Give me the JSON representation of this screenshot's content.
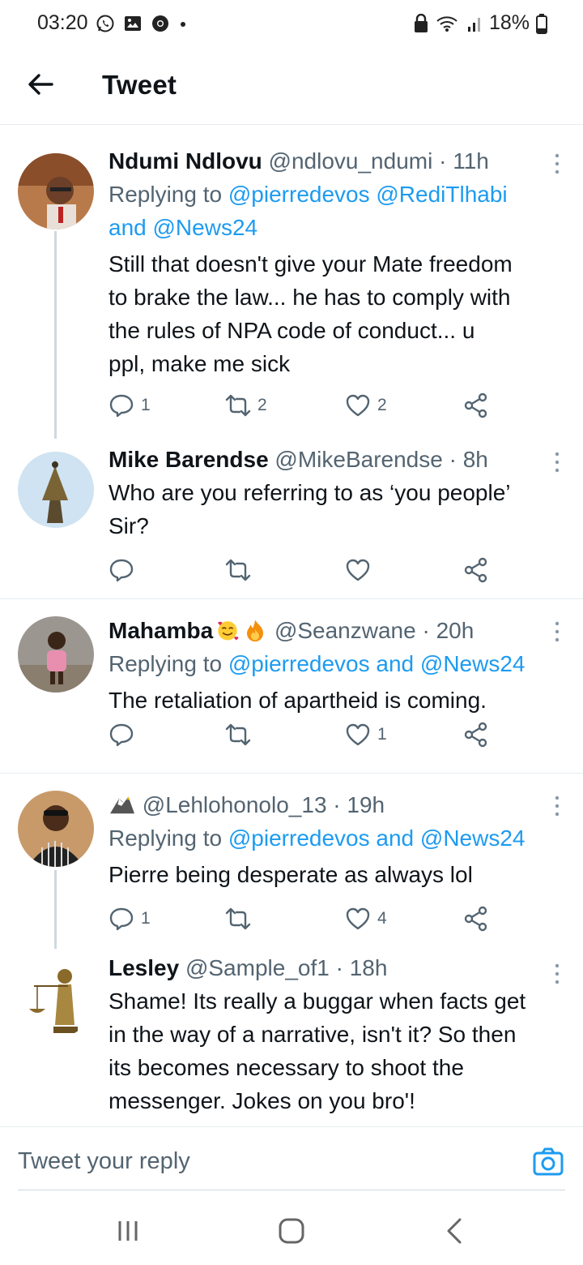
{
  "status": {
    "time": "03:20",
    "battery": "18%"
  },
  "header": {
    "title": "Tweet"
  },
  "tweets": [
    {
      "name": "Ndumi Ndlovu",
      "handle": "@ndlovu_ndumi",
      "time": "· 11h",
      "replying_prefix": "Replying to ",
      "replying_line1": "@pierredevos @RediTlhabi",
      "replying_line2_and": "and ",
      "replying_line2_link": "@News24",
      "text_lines": [
        "Still that doesn't give your Mate freedom",
        "to brake the law... he has to comply with",
        "the rules of NPA code of conduct... u",
        "ppl, make me sick"
      ],
      "replies": "1",
      "retweets": "2",
      "likes": "2"
    },
    {
      "name": "Mike Barendse",
      "handle": "@MikeBarendse",
      "time": "· 8h",
      "text_lines": [
        "Who are you referring to as ‘you people’",
        "Sir?"
      ]
    },
    {
      "name": "Mahamba",
      "handle": "@Seanzwane",
      "time": "· 20h",
      "replying_prefix": "Replying to ",
      "replying_link1": "@pierredevos",
      "replying_and": " and ",
      "replying_link2": "@News24",
      "text_lines": [
        "The retaliation of apartheid is coming."
      ],
      "likes": "1"
    },
    {
      "name": "",
      "handle": "@Lehlohonolo_13",
      "time": "· 19h",
      "replying_prefix": "Replying to ",
      "replying_link1": "@pierredevos",
      "replying_and": " and ",
      "replying_link2": "@News24",
      "text_lines": [
        "Pierre being desperate as always lol"
      ],
      "replies": "1",
      "likes": "4"
    },
    {
      "name": "Lesley",
      "handle": "@Sample_of1",
      "time": "· 18h",
      "text_lines": [
        "Shame! Its really a buggar when facts get",
        "in the way of a narrative, isn't it? So then",
        "its becomes  necessary to shoot the",
        "messenger. Jokes on you bro'!"
      ]
    }
  ],
  "compose": {
    "placeholder": "Tweet your reply"
  },
  "colors": {
    "accent": "#1d9bf0",
    "text": "#0f1419",
    "secondary": "#536471",
    "divider": "#e6ecf0"
  }
}
